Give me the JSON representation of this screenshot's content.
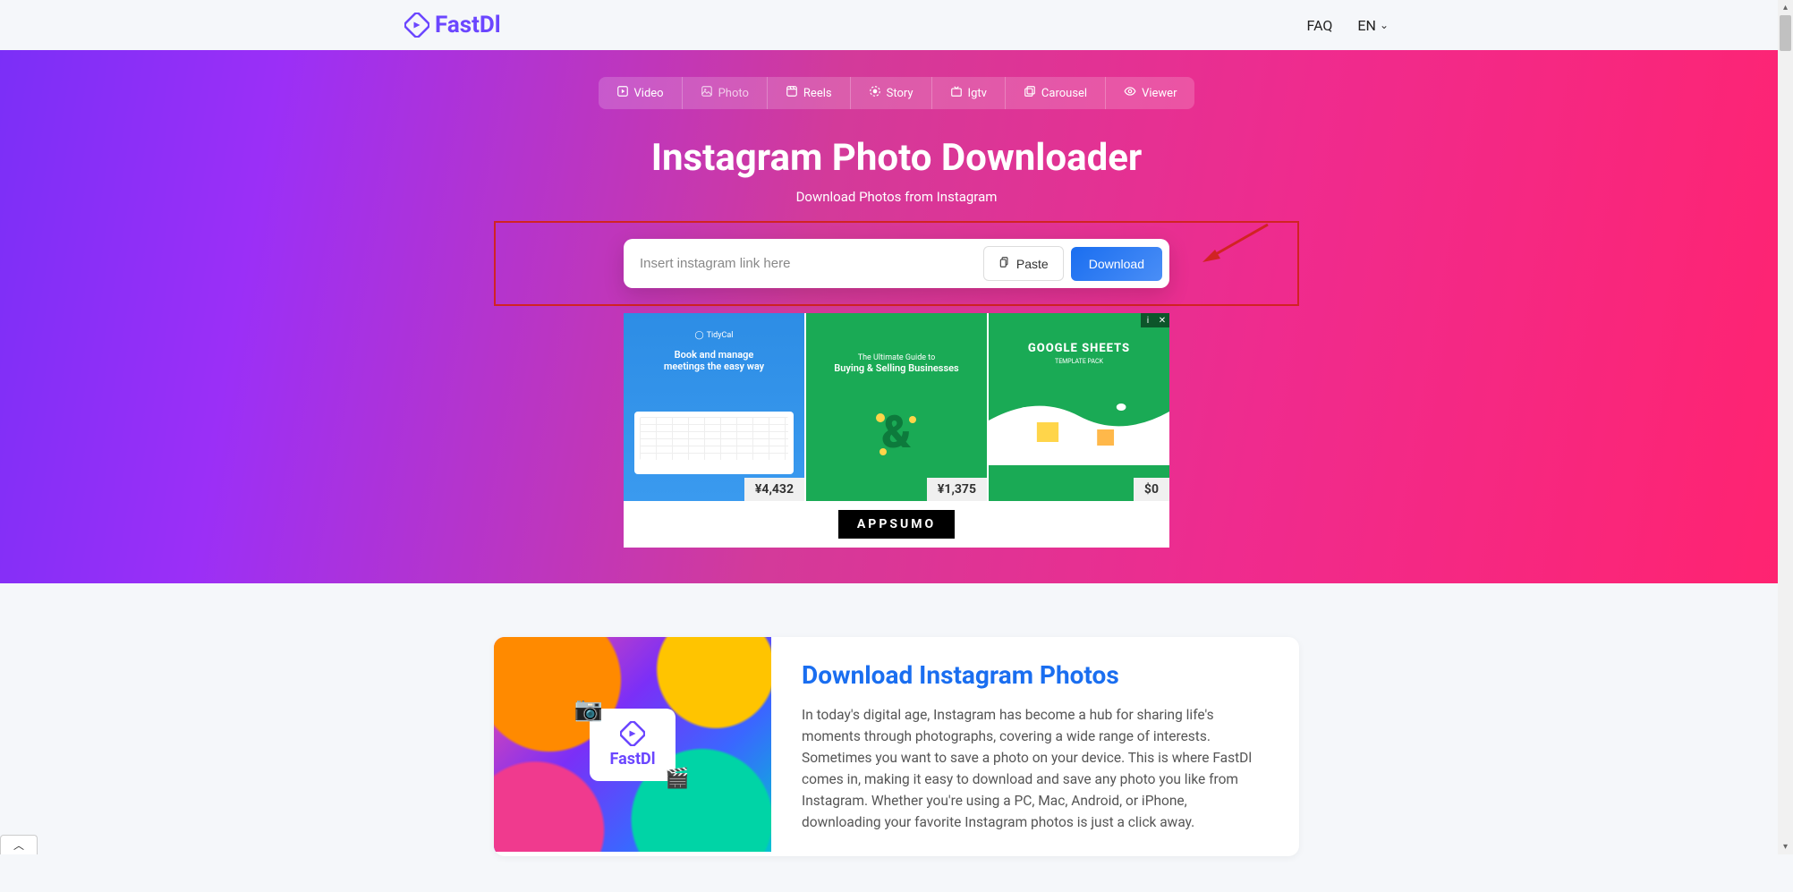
{
  "header": {
    "brand": "FastDl",
    "faq": "FAQ",
    "lang": "EN"
  },
  "tabs": [
    {
      "key": "video",
      "label": "Video"
    },
    {
      "key": "photo",
      "label": "Photo"
    },
    {
      "key": "reels",
      "label": "Reels"
    },
    {
      "key": "story",
      "label": "Story"
    },
    {
      "key": "igtv",
      "label": "Igtv"
    },
    {
      "key": "carousel",
      "label": "Carousel"
    },
    {
      "key": "viewer",
      "label": "Viewer"
    }
  ],
  "hero": {
    "title": "Instagram Photo Downloader",
    "subtitle": "Download Photos from Instagram"
  },
  "input": {
    "placeholder": "Insert instagram link here",
    "paste": "Paste",
    "download": "Download"
  },
  "ads": {
    "tidy_brand": "TidyCal",
    "card1_line1": "Book and manage",
    "card1_line2": "meetings the easy way",
    "card1_price": "¥4,432",
    "card2_line1": "The Ultimate Guide to",
    "card2_line2": "Buying & Selling Businesses",
    "card2_price": "¥1,375",
    "card3_title": "GOOGLE SHEETS",
    "card3_sub": "TEMPLATE PACK",
    "card3_price": "$0",
    "footer_brand": "APPSUMO"
  },
  "info": {
    "chip_brand": "FastDl",
    "heading": "Download Instagram Photos",
    "body": "In today's digital age, Instagram has become a hub for sharing life's moments through photographs, covering a wide range of interests. Sometimes you want to save a photo on your device. This is where FastDl comes in, making it easy to download and save any photo you like from Instagram. Whether you're using a PC, Mac, Android, or iPhone, downloading your favorite Instagram photos is just a click away."
  }
}
